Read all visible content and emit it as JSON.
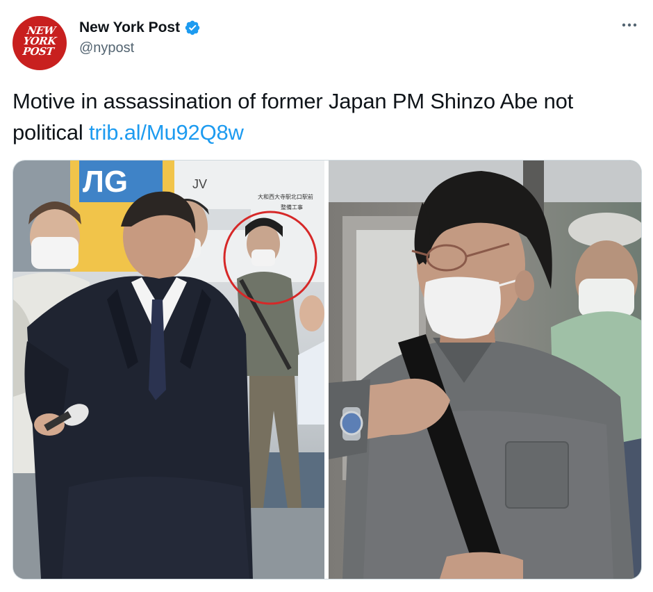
{
  "author": {
    "name": "New York Post",
    "handle": "@nypost",
    "verified": true,
    "avatar_logo_lines": [
      "NEW",
      "YORK",
      "POST"
    ]
  },
  "tweet": {
    "text": "Motive in assassination of former Japan PM Shinzo Abe not political",
    "link": "trib.al/Mu92Q8w"
  },
  "media": {
    "left_photo_text": {
      "sign_large": "ЛG",
      "sign_small": "JV",
      "sign_vertical_1": "大和西大寺駅北口駅前",
      "sign_vertical_2": "整備工事"
    }
  },
  "colors": {
    "accent": "#1d9bf0",
    "avatar_bg": "#c8201f",
    "text": "#0f1419",
    "muted": "#536471",
    "highlight_circle": "#d62828"
  },
  "icons": {
    "verified": "verified-badge-icon",
    "more": "more-options-icon"
  }
}
